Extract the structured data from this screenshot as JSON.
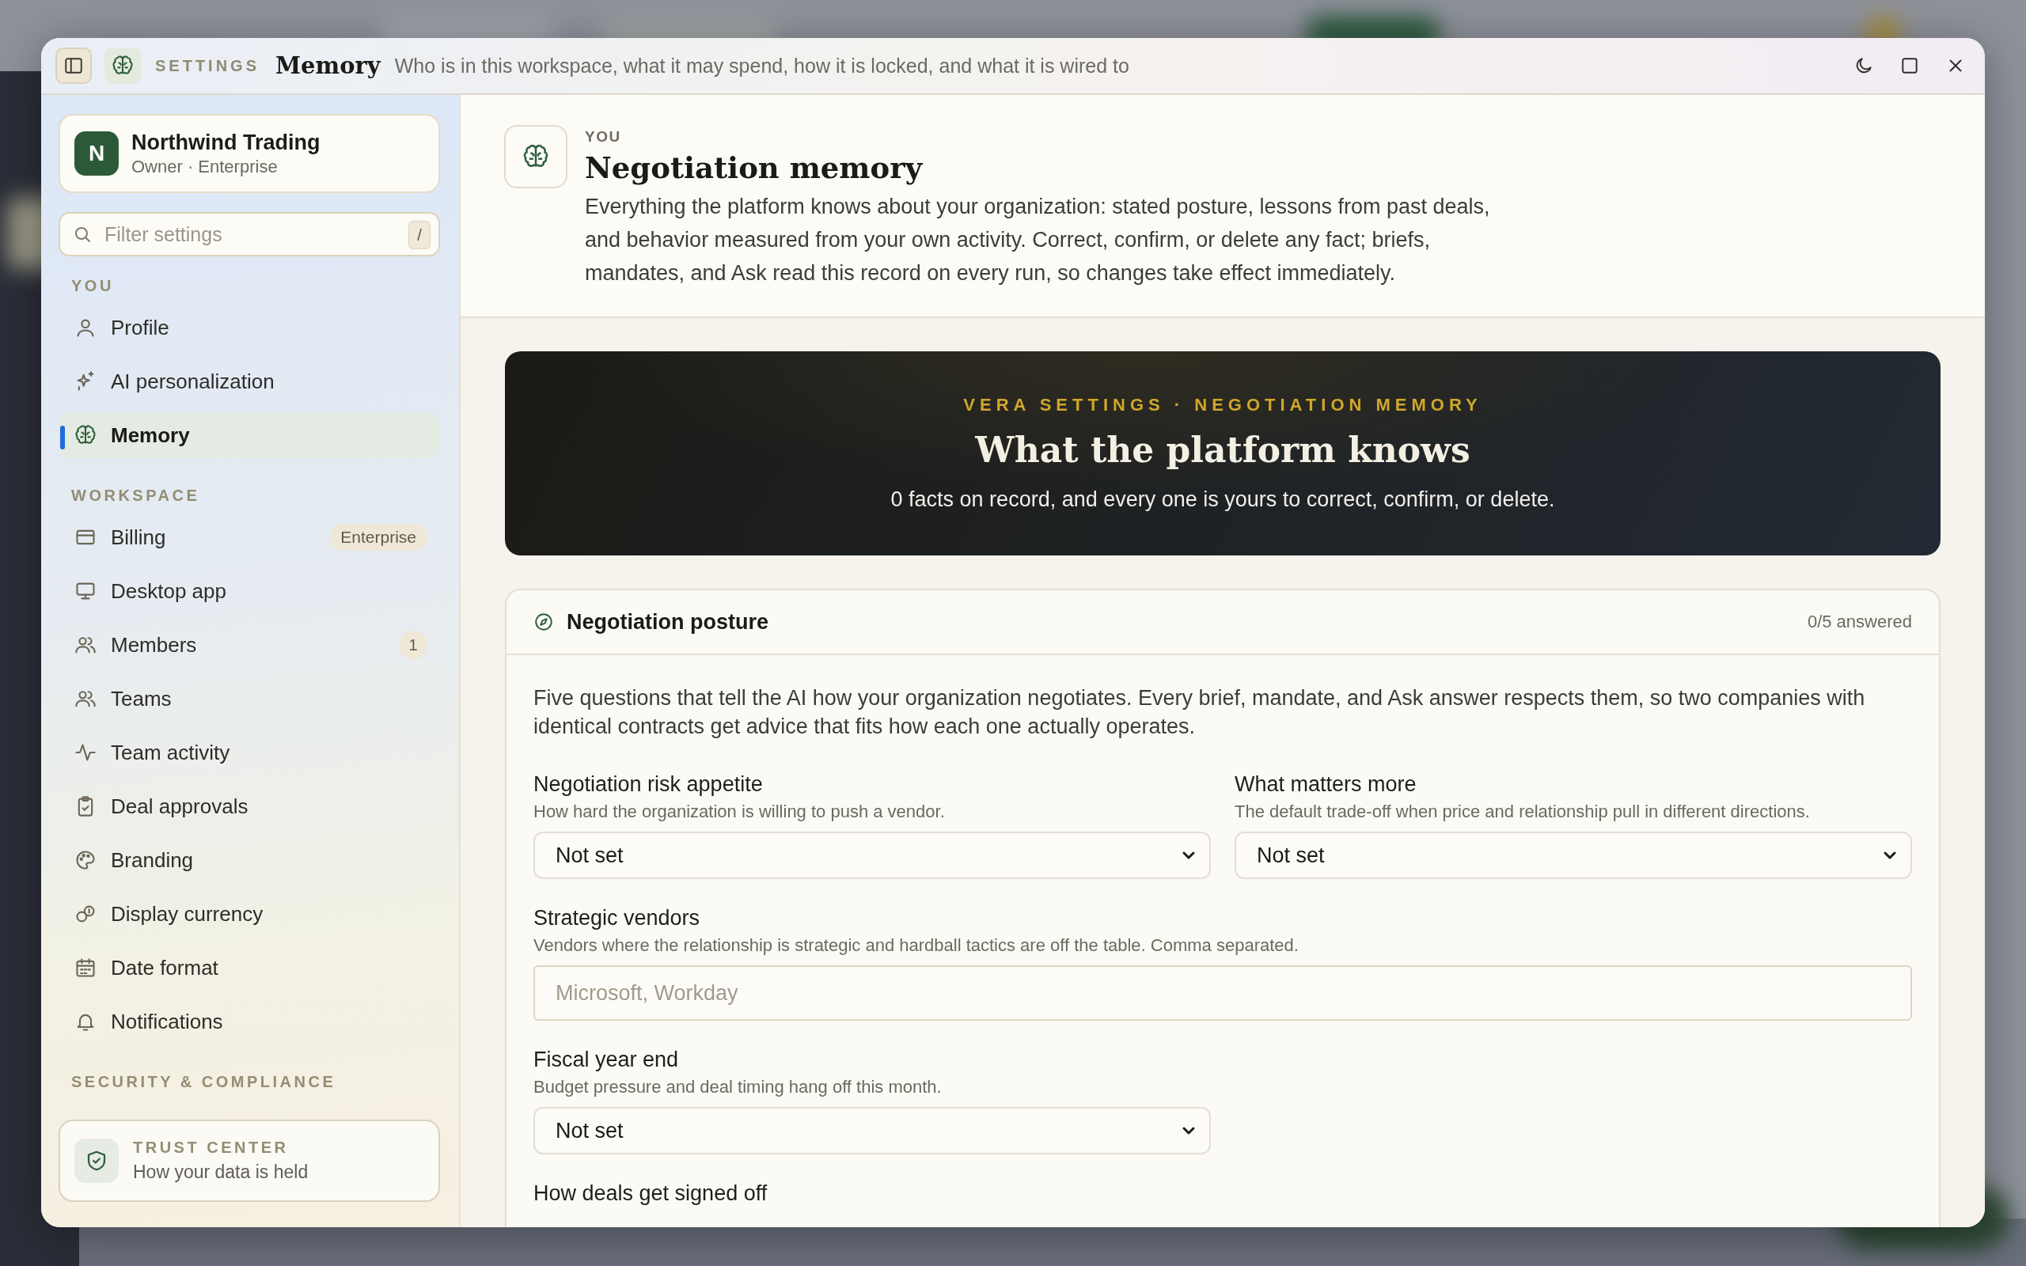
{
  "window": {
    "section": "SETTINGS",
    "title": "Memory",
    "subtitle": "Who is in this workspace, what it may spend, how it is locked, and what it is wired to"
  },
  "sidebar": {
    "org": {
      "initial": "N",
      "name": "Northwind Trading",
      "role": "Owner · Enterprise"
    },
    "filter": {
      "placeholder": "Filter settings",
      "shortcut": "/"
    },
    "sections": [
      {
        "label": "YOU",
        "items": [
          {
            "label": "Profile",
            "selected": false
          },
          {
            "label": "AI personalization",
            "selected": false
          },
          {
            "label": "Memory",
            "selected": true
          }
        ]
      },
      {
        "label": "WORKSPACE",
        "items": [
          {
            "label": "Billing",
            "selected": false,
            "badge": "Enterprise"
          },
          {
            "label": "Desktop app",
            "selected": false
          },
          {
            "label": "Members",
            "selected": false,
            "count": "1"
          },
          {
            "label": "Teams",
            "selected": false
          },
          {
            "label": "Team activity",
            "selected": false
          },
          {
            "label": "Deal approvals",
            "selected": false
          },
          {
            "label": "Branding",
            "selected": false
          },
          {
            "label": "Display currency",
            "selected": false
          },
          {
            "label": "Date format",
            "selected": false
          },
          {
            "label": "Notifications",
            "selected": false
          }
        ]
      },
      {
        "label": "SECURITY & COMPLIANCE"
      }
    ],
    "trust_center": {
      "label": "TRUST CENTER",
      "text": "How your data is held"
    }
  },
  "header": {
    "eyebrow": "YOU",
    "title": "Negotiation memory",
    "description": "Everything the platform knows about your organization: stated posture, lessons from past deals, and behavior measured from your own activity. Correct, confirm, or delete any fact; briefs, mandates, and Ask read this record on every run, so changes take effect immediately."
  },
  "banner": {
    "eyebrow": "VERA SETTINGS · NEGOTIATION MEMORY",
    "title": "What the platform knows",
    "text": "0 facts on record, and every one is yours to correct, confirm, or delete."
  },
  "card": {
    "title": "Negotiation posture",
    "count": "0/5 answered",
    "intro": "Five questions that tell the AI how your organization negotiates. Every brief, mandate, and Ask answer respects them, so two companies with identical contracts get advice that fits how each one actually operates.",
    "rows": [
      [
        {
          "kind": "select",
          "label": "Negotiation risk appetite",
          "hint": "How hard the organization is willing to push a vendor.",
          "value": "Not set"
        },
        {
          "kind": "select",
          "label": "What matters more",
          "hint": "The default trade-off when price and relationship pull in different directions.",
          "value": "Not set"
        }
      ],
      [
        {
          "kind": "text",
          "label": "Strategic vendors",
          "hint": "Vendors where the relationship is strategic and hardball tactics are off the table. Comma separated.",
          "placeholder": "Microsoft, Workday"
        }
      ],
      [
        {
          "kind": "select",
          "label": "Fiscal year end",
          "hint": "Budget pressure and deal timing hang off this month.",
          "value": "Not set"
        }
      ],
      [
        {
          "label": "How deals get signed off"
        }
      ]
    ]
  }
}
